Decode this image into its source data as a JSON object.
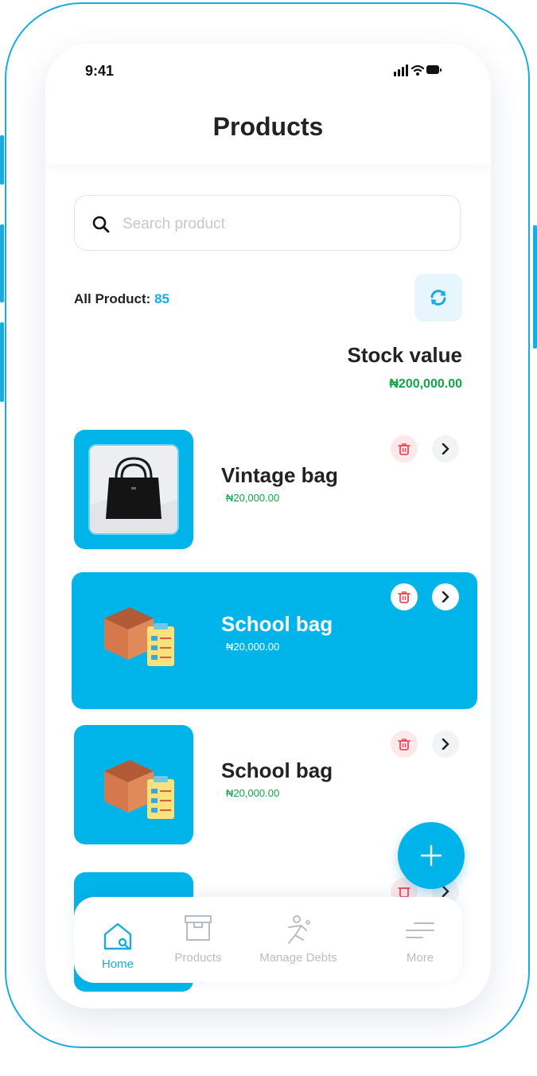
{
  "status": {
    "time": "9:41"
  },
  "header": {
    "title": "Products"
  },
  "search": {
    "placeholder": "Search product"
  },
  "summary": {
    "label": "All Product:",
    "count": "85"
  },
  "stock": {
    "label": "Stock value",
    "value": "₦200,000.00"
  },
  "products": [
    {
      "name": "Vintage bag",
      "price": "₦20,000.00",
      "image": "bag-photo",
      "selected": false
    },
    {
      "name": "School bag",
      "price": "₦20,000.00",
      "image": "box-checklist-icon",
      "selected": true
    },
    {
      "name": "School bag",
      "price": "₦20,000.00",
      "image": "box-checklist-icon",
      "selected": false
    }
  ],
  "nav": [
    {
      "label": "Home",
      "icon": "home-search-icon",
      "active": true
    },
    {
      "label": "Products",
      "icon": "box-icon",
      "active": false
    },
    {
      "label": "Manage Debts",
      "icon": "runner-icon",
      "active": false
    },
    {
      "label": "More",
      "icon": "menu-icon",
      "active": false
    }
  ],
  "colors": {
    "accent": "#00B4EA",
    "price": "#15A34A",
    "danger": "#F04B5A"
  }
}
